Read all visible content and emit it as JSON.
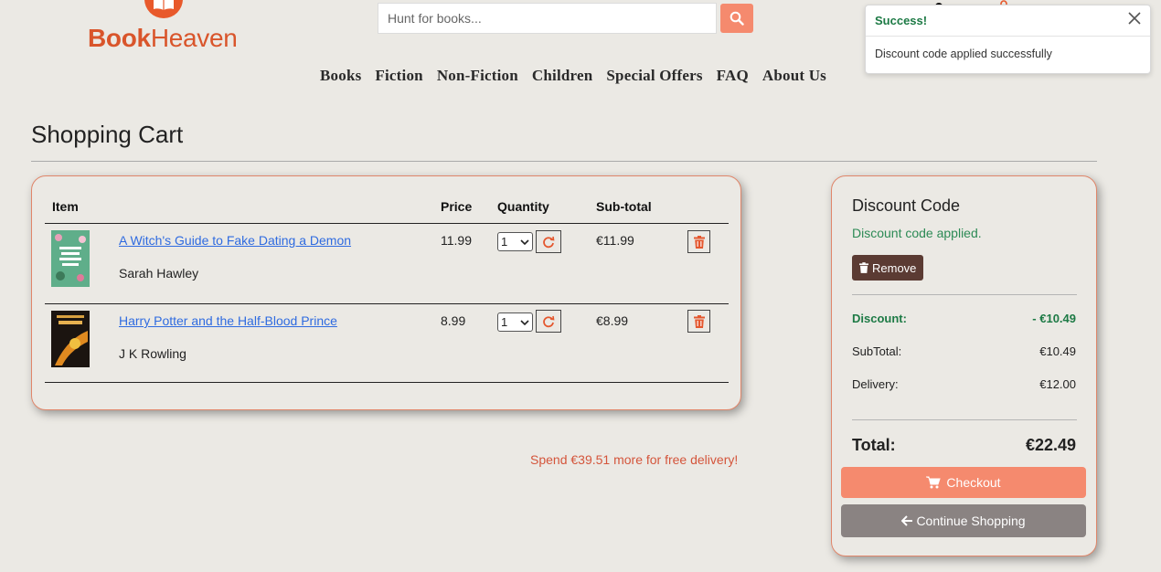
{
  "brand": {
    "name_bold": "Book",
    "name_regular": "Heaven",
    "logo_icon": "open-book-icon"
  },
  "search": {
    "placeholder": "Hunt for books...",
    "icon": "search-icon"
  },
  "nav": [
    "Books",
    "Fiction",
    "Non-Fiction",
    "Children",
    "Special Offers",
    "FAQ",
    "About Us"
  ],
  "toast": {
    "title": "Success!",
    "message": "Discount code applied successfully"
  },
  "page_title": "Shopping Cart",
  "cart": {
    "headers": {
      "item": "Item",
      "price": "Price",
      "quantity": "Quantity",
      "subtotal": "Sub-total"
    },
    "items": [
      {
        "title": "A Witch's Guide to Fake Dating a Demon",
        "author": "Sarah Hawley",
        "price": "11.99",
        "quantity": "1",
        "subtotal": "€11.99"
      },
      {
        "title": "Harry Potter and the Half-Blood Prince",
        "author": "J K Rowling",
        "price": "8.99",
        "quantity": "1",
        "subtotal": "€8.99"
      }
    ],
    "free_delivery_msg": "Spend €39.51 more for free delivery!"
  },
  "discount": {
    "title": "Discount Code",
    "status": "Discount code applied.",
    "remove_label": "Remove",
    "discount_label": "Discount:",
    "discount_value": "- €10.49",
    "subtotal_label": "SubTotal:",
    "subtotal_value": "€10.49",
    "delivery_label": "Delivery:",
    "delivery_value": "€12.00",
    "total_label": "Total:",
    "total_value": "€22.49",
    "checkout_label": "Checkout",
    "continue_label": "Continue Shopping"
  },
  "colors": {
    "accent": "#f58a6e",
    "brand": "#d9552b",
    "success": "#1d7a45",
    "background": "#ebe9e4"
  }
}
